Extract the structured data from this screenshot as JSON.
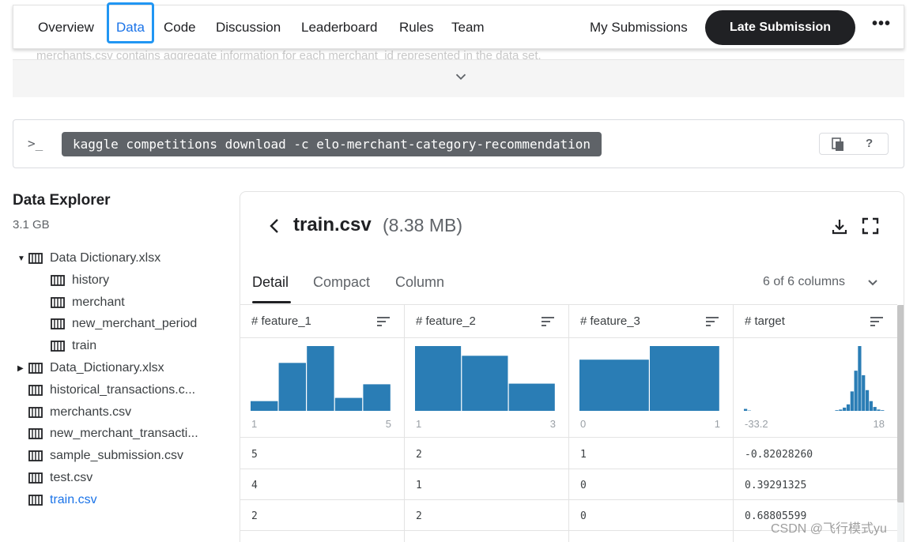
{
  "nav": {
    "tabs": [
      "Overview",
      "Data",
      "Code",
      "Discussion",
      "Leaderboard",
      "Rules",
      "Team"
    ],
    "active_tab": "Data",
    "my_submissions": "My Submissions",
    "late_submission": "Late Submission",
    "more": "•••"
  },
  "behind_text": "merchants.csv contains aggregate information for each merchant_id represented in the data set.",
  "command": {
    "prompt_icon": ">_",
    "text": "kaggle competitions download -c elo-merchant-category-recommendation",
    "help": "?"
  },
  "explorer": {
    "title": "Data Explorer",
    "size": "3.1 GB",
    "tree": [
      {
        "label": "Data Dictionary.xlsx",
        "caret": "▼",
        "indent": 0
      },
      {
        "label": "history",
        "caret": "",
        "indent": 1
      },
      {
        "label": "merchant",
        "caret": "",
        "indent": 1
      },
      {
        "label": "new_merchant_period",
        "caret": "",
        "indent": 1
      },
      {
        "label": "train",
        "caret": "",
        "indent": 1
      },
      {
        "label": "Data_Dictionary.xlsx",
        "caret": "▶",
        "indent": 0
      },
      {
        "label": "historical_transactions.c...",
        "caret": "",
        "indent": 0
      },
      {
        "label": "merchants.csv",
        "caret": "",
        "indent": 0
      },
      {
        "label": "new_merchant_transacti...",
        "caret": "",
        "indent": 0
      },
      {
        "label": "sample_submission.csv",
        "caret": "",
        "indent": 0
      },
      {
        "label": "test.csv",
        "caret": "",
        "indent": 0
      },
      {
        "label": "train.csv",
        "caret": "",
        "indent": 0,
        "selected": true
      }
    ]
  },
  "file": {
    "name": "train.csv",
    "size": "(8.38 MB)",
    "view_tabs": [
      "Detail",
      "Compact",
      "Column"
    ],
    "active_view": "Detail",
    "column_count": "6 of 6 columns"
  },
  "columns": [
    {
      "name": "# feature_1",
      "min": "1",
      "max": "5",
      "hist": [
        0.15,
        0.74,
        1.0,
        0.2,
        0.41
      ],
      "cells": [
        "5",
        "4",
        "2"
      ]
    },
    {
      "name": "# feature_2",
      "min": "1",
      "max": "3",
      "hist": [
        1.0,
        0.85,
        0.42
      ],
      "cells": [
        "2",
        "1",
        "2"
      ]
    },
    {
      "name": "# feature_3",
      "min": "0",
      "max": "1",
      "hist": [
        0.79,
        1.0
      ],
      "cells": [
        "1",
        "0",
        "0"
      ]
    },
    {
      "name": "# target",
      "min": "-33.2",
      "max": "18",
      "hist": [
        0.03,
        0.005,
        0,
        0,
        0,
        0,
        0,
        0,
        0,
        0,
        0,
        0,
        0,
        0,
        0,
        0,
        0,
        0,
        0,
        0,
        0,
        0,
        0,
        0,
        0.01,
        0.02,
        0.05,
        0.1,
        0.3,
        0.62,
        1.0,
        0.55,
        0.32,
        0.15,
        0.06,
        0.02,
        0.01
      ],
      "cells": [
        "-0.82028260",
        "0.39291325",
        "0.68805599"
      ]
    }
  ],
  "colors": {
    "bar": "#2a7db5",
    "accent": "#1a73e8",
    "focus": "#2196f3",
    "button": "#202124"
  },
  "watermark": "CSDN @飞行模式yu"
}
